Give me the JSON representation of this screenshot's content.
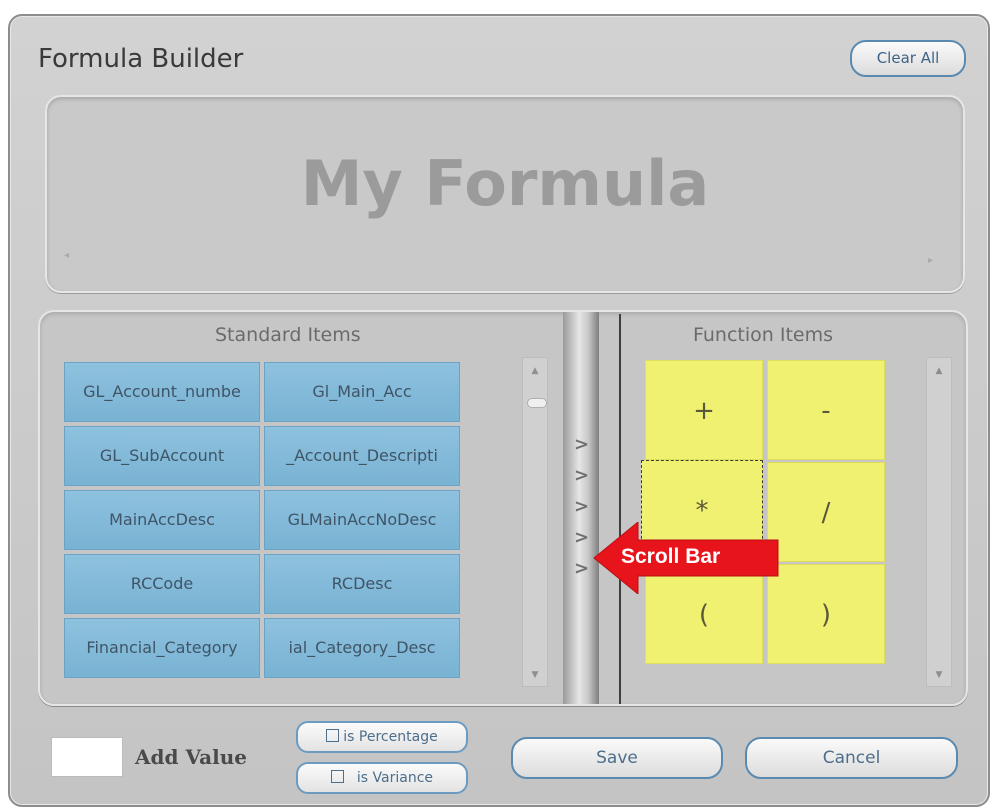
{
  "dialog": {
    "title": "Formula Builder",
    "clear_all_label": "Clear All"
  },
  "formula": {
    "text": "My Formula"
  },
  "standard_items": {
    "title": "Standard Items",
    "buttons": [
      "GL_Account_numbe",
      "Gl_Main_Acc",
      "GL_SubAccount",
      "_Account_Descripti",
      "MainAccDesc",
      "GLMainAccNoDesc",
      "RCCode",
      "RCDesc",
      "Financial_Category",
      "ial_Category_Desc"
    ]
  },
  "function_items": {
    "title": "Function Items",
    "buttons": [
      "+",
      "-",
      "*",
      "/",
      "(",
      ")"
    ]
  },
  "annotation": {
    "label": "Scroll Bar",
    "color": "#e8141b"
  },
  "splitter": {
    "arrows": [
      ">",
      ">",
      ">",
      ">",
      ">"
    ]
  },
  "footer": {
    "add_value_label": "Add Value",
    "is_percentage_label": "is Percentage",
    "is_variance_label": "is Variance",
    "save_label": "Save",
    "cancel_label": "Cancel"
  },
  "colors": {
    "standard_button": "#84bbdb",
    "function_button": "#f0f071",
    "button_border_accent": "#5a8ab0"
  }
}
